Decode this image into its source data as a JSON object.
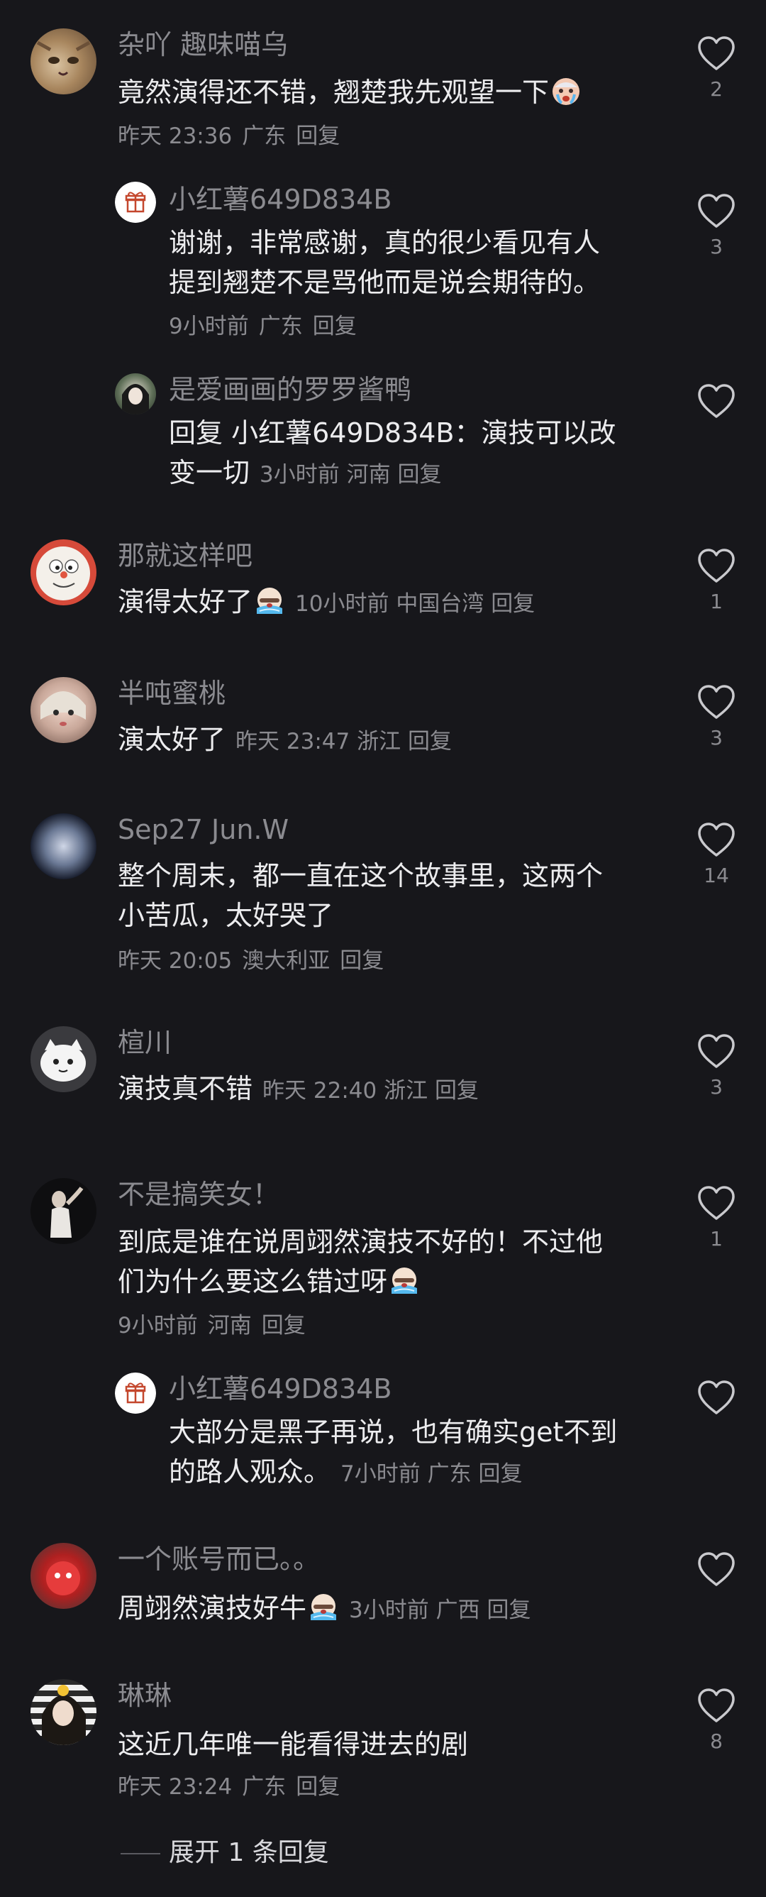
{
  "comments": [
    {
      "user": "杂吖 趣味喵乌",
      "text": "竟然演得还不错，翘楚我先观望一下",
      "time": "昨天 23:36",
      "loc": "广东",
      "reply": "回复",
      "likes": "2",
      "emoji": "cry",
      "avatar": "cat-avatar"
    },
    {
      "user": "小红薯649D834B",
      "text1": "谢谢，非常感谢，真的很少看见有人",
      "text2": "提到翘楚不是骂他而是说会期待的。",
      "time": "9小时前",
      "loc": "广东",
      "reply": "回复",
      "likes": "3",
      "avatar": "gift-avatar"
    },
    {
      "user": "是爱画画的罗罗酱鸭",
      "text1": "回复  小红薯649D834B：演技可以改",
      "text2": "变一切",
      "time": "3小时前",
      "loc": "河南",
      "reply": "回复",
      "likes": "",
      "avatar": "girl-avatar"
    },
    {
      "user": "那就这样吧",
      "text": "演得太好了",
      "time": "10小时前",
      "loc": "中国台湾",
      "reply": "回复",
      "likes": "1",
      "emoji": "sob",
      "avatar": "doraemon-avatar"
    },
    {
      "user": "半吨蜜桃",
      "text": "演太好了",
      "time": "昨天 23:47",
      "loc": "浙江",
      "reply": "回复",
      "likes": "3",
      "avatar": "doll-avatar"
    },
    {
      "user": "Sep27 Jun.W",
      "text1": "整个周末，都一直在这个故事里，这两个",
      "text2": "小苦瓜，太好哭了",
      "time": "昨天 20:05",
      "loc": "澳大利亚",
      "reply": "回复",
      "likes": "14",
      "avatar": "moon-avatar"
    },
    {
      "user": "楦川",
      "text": "演技真不错",
      "time": "昨天 22:40",
      "loc": "浙江",
      "reply": "回复",
      "likes": "3",
      "avatar": "cartoon-avatar"
    },
    {
      "user": "不是搞笑女！",
      "text1": "到底是谁在说周翊然演技不好的！不过他",
      "text2": "们为什么要这么错过呀",
      "time": "9小时前",
      "loc": "河南",
      "reply": "回复",
      "likes": "1",
      "emoji": "sob",
      "avatar": "pose-avatar"
    },
    {
      "user": "小红薯649D834B",
      "text1": "大部分是黑子再说，也有确实get不到",
      "text2": "的路人观众。",
      "time": "7小时前",
      "loc": "广东",
      "reply": "回复",
      "likes": "",
      "avatar": "gift-avatar"
    },
    {
      "user": "一个账号而已。。",
      "text": "周翊然演技好牛",
      "time": "3小时前",
      "loc": "广西",
      "reply": "回复",
      "likes": "",
      "emoji": "sob",
      "avatar": "red-avatar"
    },
    {
      "user": "琳琳",
      "text": "这近几年唯一能看得进去的剧",
      "time": "昨天 23:24",
      "loc": "广东",
      "reply": "回复",
      "likes": "8",
      "avatar": "woman-avatar"
    }
  ],
  "expand_label": "展开 1 条回复",
  "colors": {
    "background": "#17171b",
    "text": "#ececee",
    "muted": "#8b8b90"
  }
}
